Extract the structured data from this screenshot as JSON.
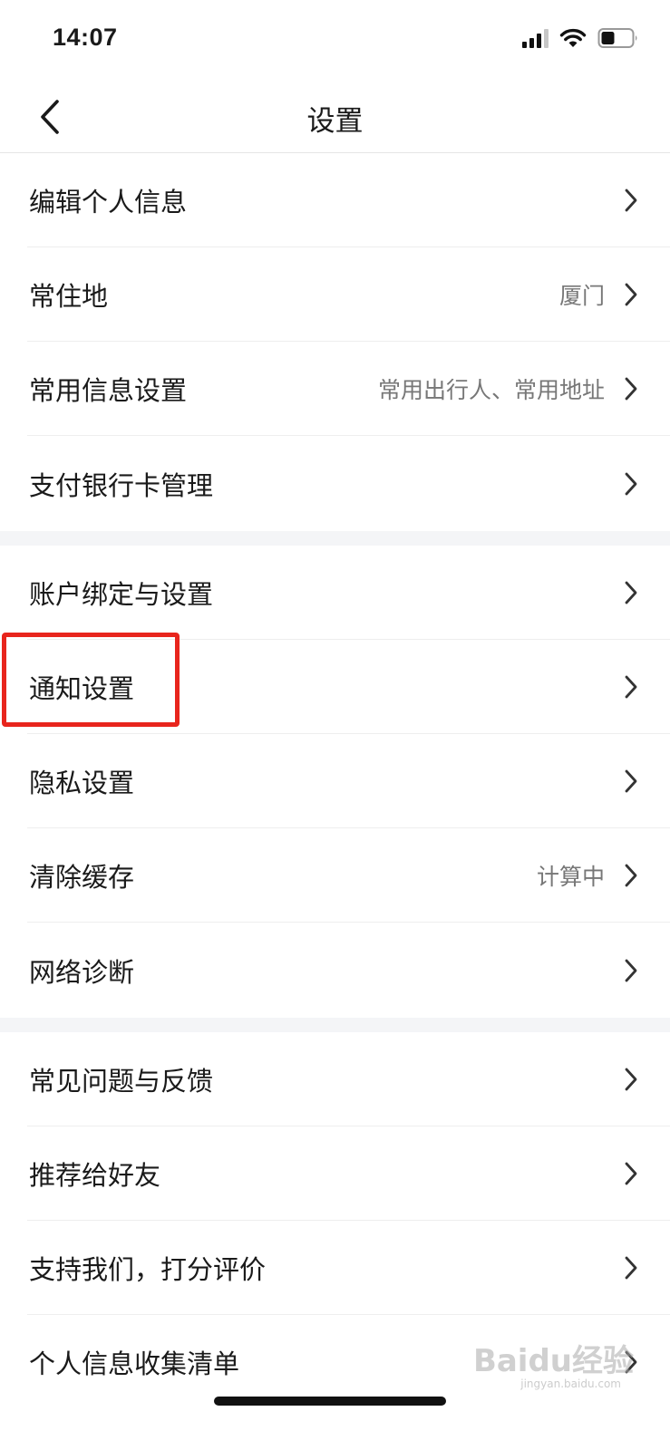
{
  "status": {
    "time": "14:07"
  },
  "header": {
    "title": "设置"
  },
  "groups": [
    {
      "items": [
        {
          "label": "编辑个人信息",
          "value": ""
        },
        {
          "label": "常住地",
          "value": "厦门"
        },
        {
          "label": "常用信息设置",
          "value": "常用出行人、常用地址"
        },
        {
          "label": "支付银行卡管理",
          "value": ""
        }
      ]
    },
    {
      "items": [
        {
          "label": "账户绑定与设置",
          "value": ""
        },
        {
          "label": "通知设置",
          "value": ""
        },
        {
          "label": "隐私设置",
          "value": ""
        },
        {
          "label": "清除缓存",
          "value": "计算中"
        },
        {
          "label": "网络诊断",
          "value": ""
        }
      ]
    },
    {
      "items": [
        {
          "label": "常见问题与反馈",
          "value": ""
        },
        {
          "label": "推荐给好友",
          "value": ""
        },
        {
          "label": "支持我们，打分评价",
          "value": ""
        },
        {
          "label": "个人信息收集清单",
          "value": ""
        }
      ]
    }
  ],
  "watermark": {
    "text": "Baidu经验",
    "sub": "jingyan.baidu.com"
  },
  "colors": {
    "highlight": "#e8251d",
    "section_gap": "#f4f5f7"
  }
}
